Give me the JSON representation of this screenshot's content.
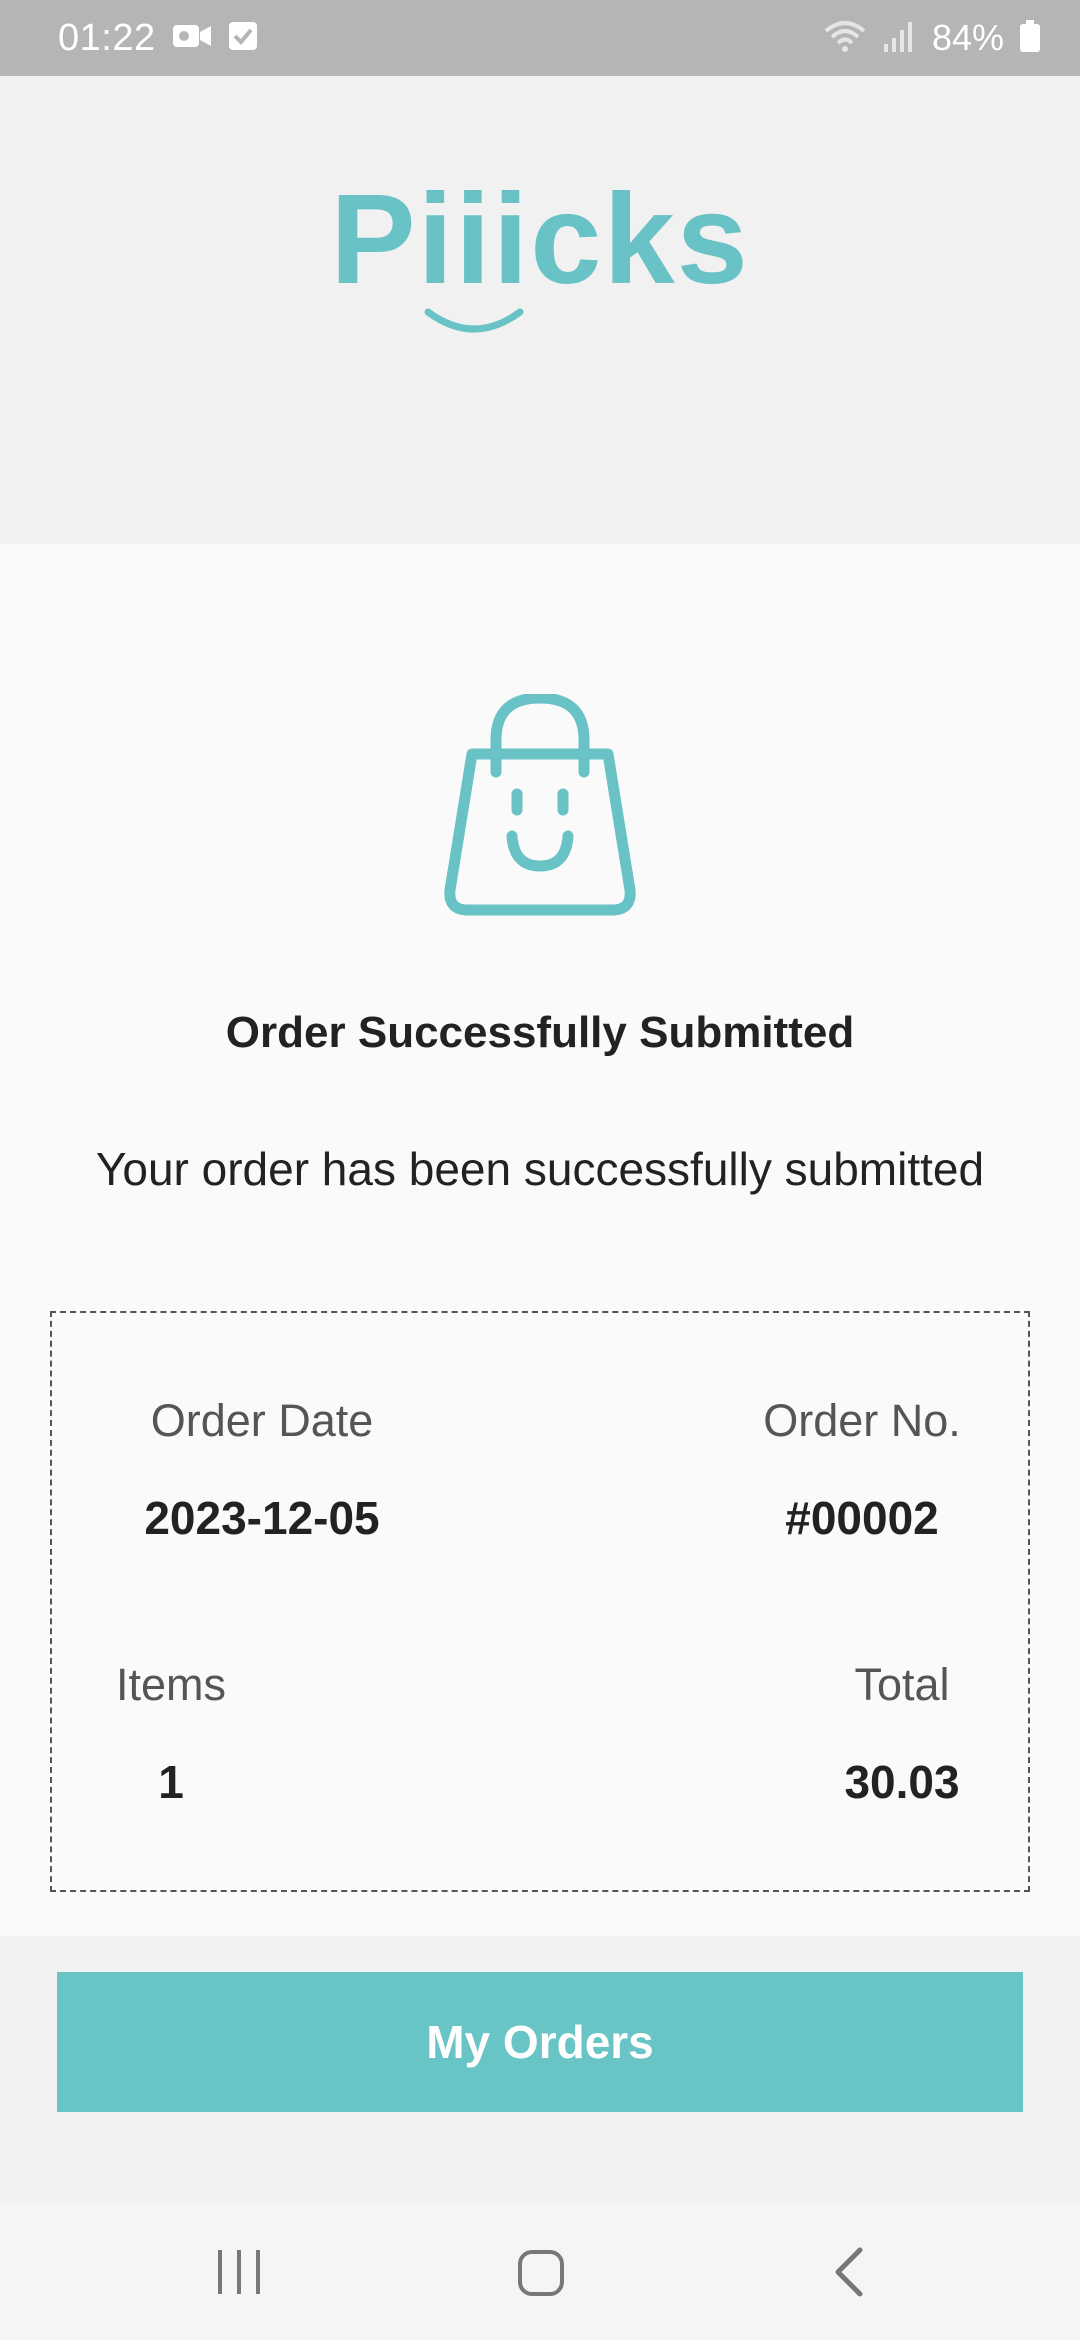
{
  "status_bar": {
    "time": "01:22",
    "battery": "84%"
  },
  "header": {
    "logo_text": "Piiicks",
    "brand_color": "#69c3c6"
  },
  "confirmation": {
    "title": "Order Successfully Submitted",
    "message": "Your order has been successfully submitted"
  },
  "summary": {
    "order_date_label": "Order Date",
    "order_date": "2023-12-05",
    "order_no_label": "Order No.",
    "order_no": "#00002",
    "items_label": "Items",
    "items": "1",
    "total_label": "Total",
    "total": "30.03"
  },
  "actions": {
    "my_orders_label": "My Orders"
  },
  "icons": {
    "status": [
      "video-camera-icon",
      "checkbox-icon",
      "wifi-icon",
      "signal-icon",
      "battery-icon"
    ],
    "main": "shopping-bag-smile-icon",
    "nav": [
      "recents-icon",
      "home-icon",
      "back-icon"
    ]
  }
}
